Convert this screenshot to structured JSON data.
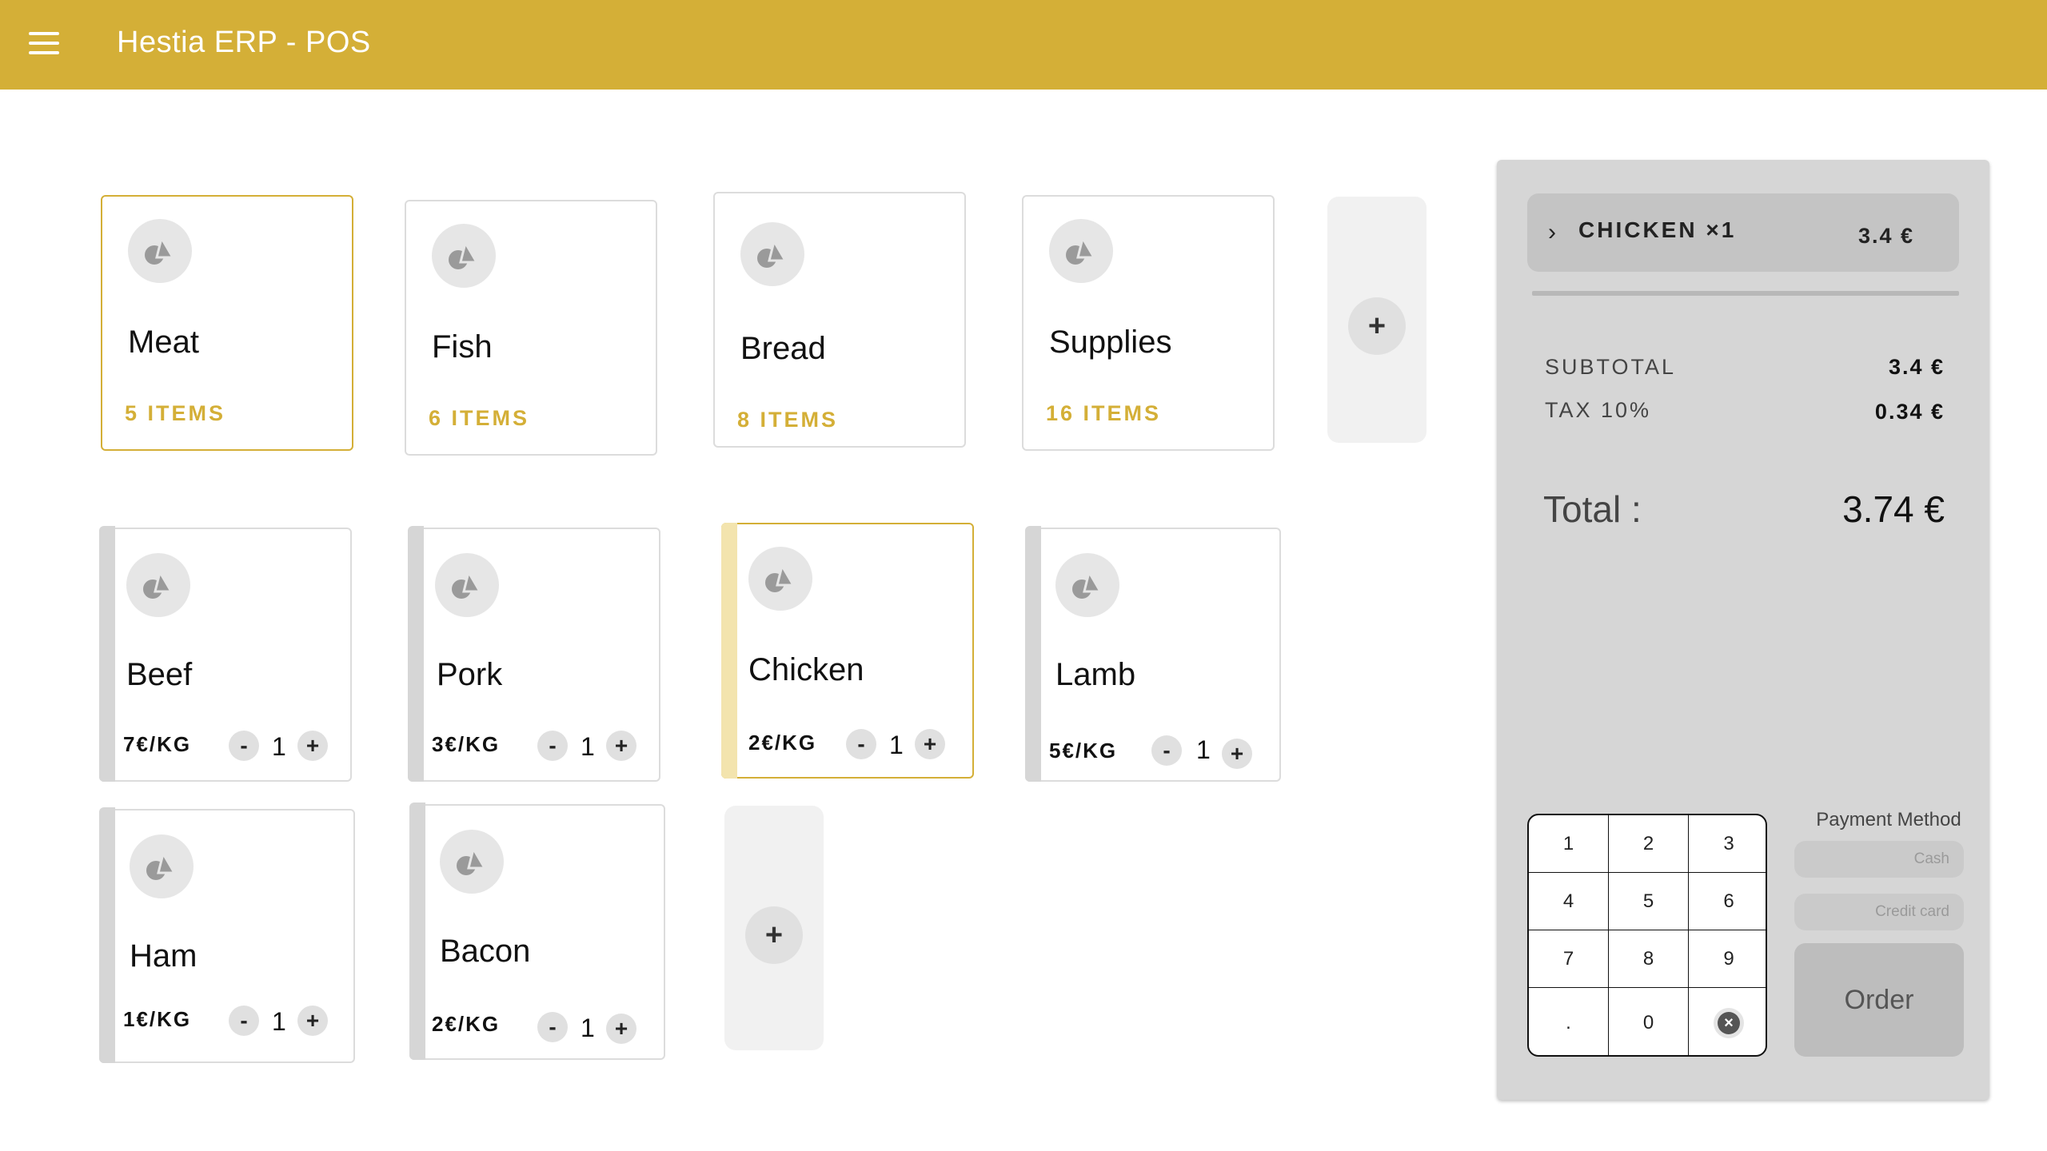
{
  "app": {
    "title": "Hestia ERP - POS"
  },
  "categories": [
    {
      "name": "Meat",
      "count": "5 ITEMS",
      "selected": true
    },
    {
      "name": "Fish",
      "count": "6 ITEMS"
    },
    {
      "name": "Bread",
      "count": "8 ITEMS"
    },
    {
      "name": "Supplies",
      "count": "16 ITEMS"
    }
  ],
  "add_category_label": "+",
  "products": [
    {
      "name": "Beef",
      "price": "7€/KG",
      "qty": "1"
    },
    {
      "name": "Pork",
      "price": "3€/KG",
      "qty": "1"
    },
    {
      "name": "Chicken",
      "price": "2€/KG",
      "qty": "1",
      "selected": true
    },
    {
      "name": "Lamb",
      "price": "5€/KG",
      "qty": "1"
    },
    {
      "name": "Ham",
      "price": "1€/KG",
      "qty": "1"
    },
    {
      "name": "Bacon",
      "price": "2€/KG",
      "qty": "1"
    }
  ],
  "add_product_label": "+",
  "qty_minus": "-",
  "qty_plus": "+",
  "order": {
    "lines": [
      {
        "name": "CHICKEN ×1",
        "price": "3.4 €"
      }
    ],
    "subtotal_label": "SUBTOTAL",
    "subtotal": "3.4 €",
    "tax_label": "TAX 10%",
    "tax": "0.34 €",
    "total_label": "Total :",
    "total": "3.74 €"
  },
  "numpad": {
    "keys": [
      "1",
      "2",
      "3",
      "4",
      "5",
      "6",
      "7",
      "8",
      "9",
      ".",
      "0"
    ],
    "clear_symbol": "×"
  },
  "payment": {
    "label": "Payment Method",
    "cash": "Cash",
    "credit_card": "Credit card",
    "order_button": "Order"
  },
  "colors": {
    "accent": "#d4af37",
    "panel": "#d6d6d6",
    "tile": "#f1f1f1"
  }
}
